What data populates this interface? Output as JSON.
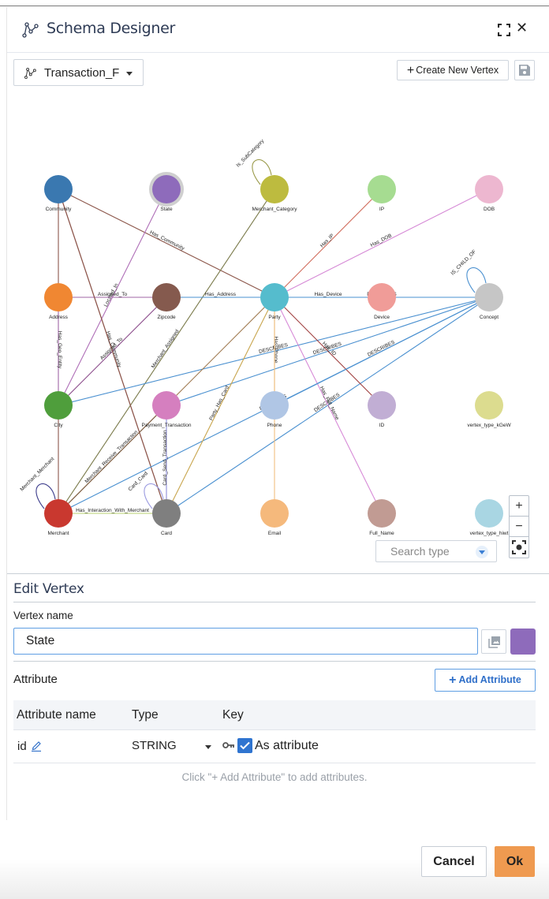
{
  "header": {
    "title": "Schema Designer",
    "icons": {
      "logo": "schema-graph-icon",
      "fullscreen": "fullscreen-icon",
      "close": "close-icon"
    },
    "close_glyph": "✕"
  },
  "toolbar": {
    "graph_select_value": "Transaction_F",
    "create_vertex_label": "Create New Vertex",
    "create_vertex_plus": "+",
    "save_icon": "save-icon"
  },
  "graph": {
    "selected_vertex": "State",
    "vertices": [
      {
        "name": "Community",
        "color": "#3a78b0",
        "col": 0,
        "row": 0
      },
      {
        "name": "State",
        "color": "#8e6bbb",
        "col": 1,
        "row": 0,
        "selected": true
      },
      {
        "name": "Merchant_Category",
        "color": "#bdbb3f",
        "col": 2,
        "row": 0
      },
      {
        "name": "IP",
        "color": "#a6dc91",
        "col": 3,
        "row": 0
      },
      {
        "name": "DOB",
        "color": "#edb7d0",
        "col": 4,
        "row": 0
      },
      {
        "name": "Address",
        "color": "#f08732",
        "col": 0,
        "row": 1
      },
      {
        "name": "Zipcode",
        "color": "#855a4e",
        "col": 1,
        "row": 1
      },
      {
        "name": "Party",
        "color": "#55bccd",
        "col": 2,
        "row": 1
      },
      {
        "name": "Device",
        "color": "#f09c98",
        "col": 3,
        "row": 1
      },
      {
        "name": "Concept",
        "color": "#c6c6c6",
        "col": 4,
        "row": 1
      },
      {
        "name": "City",
        "color": "#4f9e3c",
        "col": 0,
        "row": 2
      },
      {
        "name": "Payment_Transaction",
        "color": "#d57fbf",
        "col": 1,
        "row": 2
      },
      {
        "name": "Phone",
        "color": "#b0c6e5",
        "col": 2,
        "row": 2
      },
      {
        "name": "ID",
        "color": "#c1aed4",
        "col": 3,
        "row": 2
      },
      {
        "name": "vertex_type_kGeW",
        "color": "#dcdc8f",
        "col": 4,
        "row": 2
      },
      {
        "name": "Merchant",
        "color": "#c9382f",
        "col": 0,
        "row": 3
      },
      {
        "name": "Card",
        "color": "#7f7f7f",
        "col": 1,
        "row": 3
      },
      {
        "name": "Email",
        "color": "#f5b97c",
        "col": 2,
        "row": 3
      },
      {
        "name": "Full_Name",
        "color": "#c19b93",
        "col": 3,
        "row": 3
      },
      {
        "name": "vertex_type_hiwt",
        "color": "#a9d6e3",
        "col": 4,
        "row": 3
      }
    ],
    "edges": [
      {
        "label": "Has_Community",
        "from": "Party",
        "to": "Community",
        "color": "#8c564b"
      },
      {
        "label": "",
        "from": "Community",
        "to": "Address",
        "color": "#8c564b"
      },
      {
        "label": "",
        "from": "Community",
        "to": "Card",
        "color": "#8c564b"
      },
      {
        "label": "Located_In",
        "from": "City",
        "to": "State",
        "color": "#b070b8"
      },
      {
        "label": "Is_SubCategory",
        "from": "Merchant_Category",
        "to": "Merchant_Category",
        "color": "#9a9a4a",
        "self": true
      },
      {
        "label": "Merchant_Assigned",
        "from": "Merchant",
        "to": "Merchant_Category",
        "color": "#7a7a4a"
      },
      {
        "label": "Has_IP",
        "from": "Party",
        "to": "IP",
        "color": "#d06a5a"
      },
      {
        "label": "Has_DOB",
        "from": "Party",
        "to": "DOB",
        "color": "#d68ad6"
      },
      {
        "label": "Assigned_To",
        "from": "Address",
        "to": "Zipcode",
        "color": "#a066a6"
      },
      {
        "label": "Has_Address",
        "from": "Zipcode",
        "to": "Party",
        "color": "#4a90d0"
      },
      {
        "label": "DESCRIBES",
        "from": "Party",
        "to": "Concept",
        "color": "#4a90d0"
      },
      {
        "label": "Has_Device",
        "from": "Party",
        "to": "Device",
        "color": "#4a90d0"
      },
      {
        "label": "IS_CHILD_OF",
        "from": "Concept",
        "to": "Concept",
        "color": "#4a90d0",
        "self": true
      },
      {
        "label": "Has_Geo_Entity",
        "from": "Address",
        "to": "City",
        "color": "#a066a6"
      },
      {
        "label": "Assigned_To",
        "from": "City",
        "to": "Zipcode",
        "color": "#8a4a8a"
      },
      {
        "label": "Has_Community",
        "from": "Community",
        "to": "Card",
        "color": "#8c564b"
      },
      {
        "label": "DESCRIBES",
        "from": "City",
        "to": "Concept",
        "color": "#4a90d0"
      },
      {
        "label": "DESCRIBES",
        "from": "Payment_Transaction",
        "to": "Concept",
        "color": "#4a90d0"
      },
      {
        "label": "DESCRIBES",
        "from": "Merchant",
        "to": "Concept",
        "color": "#4a90d0"
      },
      {
        "label": "DESCRIBES",
        "from": "Card",
        "to": "Concept",
        "color": "#4a90d0"
      },
      {
        "label": "Has_ID",
        "from": "Party",
        "to": "ID",
        "color": "#a04040"
      },
      {
        "label": "Has_Phone",
        "from": "Party",
        "to": "Phone",
        "color": "#d4b06a"
      },
      {
        "label": "Party_Has_Card",
        "from": "Party",
        "to": "Card",
        "color": "#c9a650"
      },
      {
        "label": "Has_Full_Name",
        "from": "Party",
        "to": "Full_Name",
        "color": "#d78ad7"
      },
      {
        "label": "",
        "from": "Party",
        "to": "Merchant",
        "color": "#a07a50"
      },
      {
        "label": "Merchant_Receive_Transaction",
        "from": "Merchant",
        "to": "Payment_Transaction",
        "color": "#7a5a40"
      },
      {
        "label": "Card_Send_Transaction",
        "from": "Card",
        "to": "Payment_Transaction",
        "color": "#8b8bd8"
      },
      {
        "label": "Card_Card",
        "from": "Card",
        "to": "Card",
        "color": "#9a9ae0",
        "self": true
      },
      {
        "label": "Merchant_Merchant",
        "from": "Merchant",
        "to": "Merchant",
        "color": "#3a3a8a",
        "self": true
      },
      {
        "label": "Has_Interaction_With_Merchant",
        "from": "Merchant",
        "to": "Card",
        "color": "#b8d070"
      },
      {
        "label": "",
        "from": "Email",
        "to": "Party",
        "color": "#f0c080"
      },
      {
        "label": "",
        "from": "City",
        "to": "Merchant",
        "color": "#8c564b"
      },
      {
        "label": "DESCRIBES",
        "from": "Phone",
        "to": "Concept",
        "color": "#4a90d0"
      }
    ],
    "search_placeholder": "Search type",
    "zoom_in": "+",
    "zoom_out": "−",
    "recenter_icon": "recenter-icon"
  },
  "edit_vertex": {
    "title": "Edit Vertex",
    "vertex_name_label": "Vertex name",
    "vertex_name_value": "State",
    "image_icon": "image-icon",
    "color": "#8e6bbb",
    "attribute_label": "Attribute",
    "add_attribute_label": "Add Attribute",
    "add_attribute_plus": "+",
    "table": {
      "headers": [
        "Attribute name",
        "Type",
        "Key"
      ],
      "rows": [
        {
          "name": "id",
          "type": "STRING",
          "key_label": "As attribute",
          "as_attribute_checked": true
        }
      ]
    },
    "hint": "Click \"+ Add Attribute\" to add attributes."
  },
  "footer": {
    "cancel_label": "Cancel",
    "ok_label": "Ok"
  }
}
